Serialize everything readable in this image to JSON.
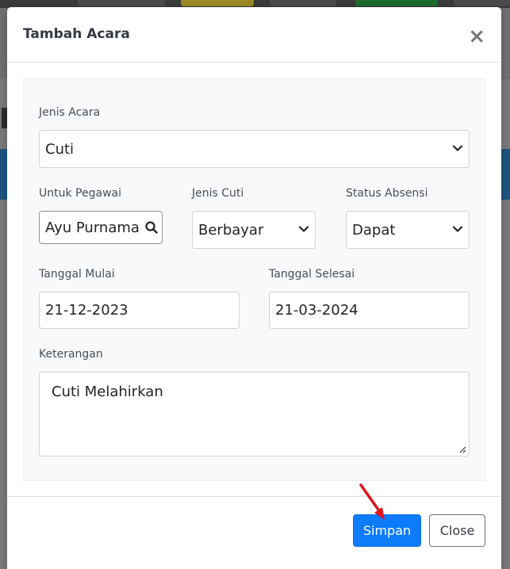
{
  "modal": {
    "title": "Tambah Acara",
    "close_symbol": "×"
  },
  "form": {
    "jenis_acara": {
      "label": "Jenis Acara",
      "value": "Cuti"
    },
    "untuk_pegawai": {
      "label": "Untuk Pegawai",
      "value": "Ayu Purnama S"
    },
    "jenis_cuti": {
      "label": "Jenis Cuti",
      "value": "Berbayar"
    },
    "status_absensi": {
      "label": "Status Absensi",
      "value": "Dapat"
    },
    "tanggal_mulai": {
      "label": "Tanggal Mulai",
      "value": "21-12-2023"
    },
    "tanggal_selesai": {
      "label": "Tanggal Selesai",
      "value": "21-03-2024"
    },
    "keterangan": {
      "label": "Keterangan",
      "value": "Cuti Melahirkan"
    }
  },
  "footer": {
    "save_label": "Simpan",
    "close_label": "Close"
  },
  "colors": {
    "primary": "#0d7bfa",
    "annotation_arrow": "#e0141e"
  },
  "icons": {
    "select": "chevron-down-icon",
    "search": "search-icon",
    "close": "close-icon"
  }
}
